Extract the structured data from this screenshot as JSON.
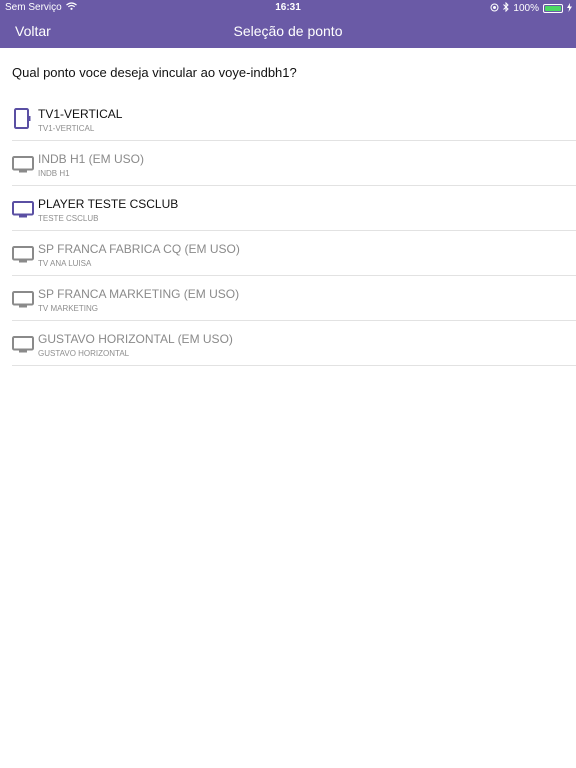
{
  "status_bar": {
    "carrier": "Sem Serviço",
    "time": "16:31",
    "battery": "100%",
    "battery_level": 1.0
  },
  "nav": {
    "back_label": "Voltar",
    "title": "Seleção de ponto"
  },
  "question": "Qual ponto voce deseja vincular ao voye-indbh1?",
  "colors": {
    "header": "#6a5aa6",
    "accent_icon": "#5a4fa3",
    "disabled_icon": "#8a8a8a"
  },
  "items": [
    {
      "title": "TV1-VERTICAL",
      "subtitle": "TV1-VERTICAL",
      "icon": "tv-vertical-icon",
      "state": "available"
    },
    {
      "title": "INDB H1 (EM USO)",
      "subtitle": "INDB H1",
      "icon": "tv-icon",
      "state": "in-use"
    },
    {
      "title": "PLAYER TESTE CSCLUB",
      "subtitle": "TESTE CSCLUB",
      "icon": "tv-icon",
      "state": "available"
    },
    {
      "title": "SP FRANCA FABRICA CQ (EM USO)",
      "subtitle": "TV ANA LUISA",
      "icon": "tv-icon",
      "state": "in-use"
    },
    {
      "title": "SP FRANCA MARKETING (EM USO)",
      "subtitle": "TV MARKETING",
      "icon": "tv-icon",
      "state": "in-use"
    },
    {
      "title": "GUSTAVO HORIZONTAL (EM USO)",
      "subtitle": "GUSTAVO HORIZONTAL",
      "icon": "tv-icon",
      "state": "in-use"
    }
  ]
}
